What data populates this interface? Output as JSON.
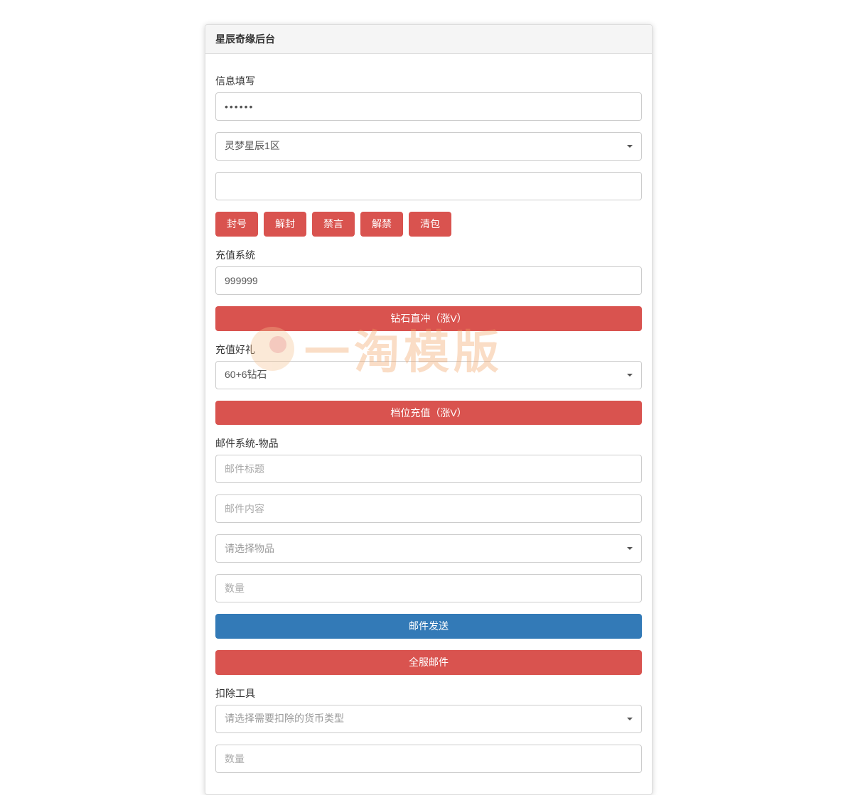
{
  "panel": {
    "title": "星辰奇缘后台"
  },
  "info": {
    "label": "信息填写",
    "password_value": "••••••",
    "server_selected": "灵梦星辰1区",
    "target_value": ""
  },
  "actions": {
    "ban": "封号",
    "unban": "解封",
    "mute": "禁言",
    "unmute": "解禁",
    "clear_bag": "清包"
  },
  "recharge": {
    "label": "充值系统",
    "amount_value": "999999",
    "direct_btn": "钻石直冲（涨V）"
  },
  "gift": {
    "label": "充值好礼",
    "tier_selected": "60+6钻石",
    "tier_btn": "档位充值（涨V）"
  },
  "mail": {
    "label": "邮件系统-物品",
    "title_placeholder": "邮件标题",
    "content_placeholder": "邮件内容",
    "item_placeholder": "请选择物品",
    "qty_placeholder": "数量",
    "send_btn": "邮件发送",
    "broadcast_btn": "全服邮件"
  },
  "deduct": {
    "label": "扣除工具",
    "currency_placeholder": "请选择需要扣除的货币类型",
    "qty_placeholder": "数量"
  },
  "watermark": {
    "text": "一淘模版"
  }
}
